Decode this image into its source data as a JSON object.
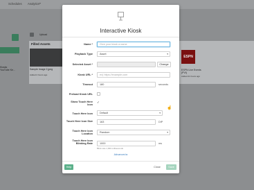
{
  "topbar": {
    "menu1": "Schedules",
    "menu2": "Analytics",
    "menu2_arrow": "▾"
  },
  "background": {
    "left_text": "Kiosks\nYouTube Ke...",
    "upload_label": "Upload",
    "panel_title": "Filled Assets",
    "thumb_title": "Sample Image 2.jpeg",
    "thumb_sub": "Added 2 hours ago",
    "espn": "ESPN",
    "right_text1": "ESPN Live Events",
    "right_text2": "(PVI)",
    "right_text3": "Added 21 hours ago"
  },
  "modal": {
    "title": "Interactive Kiosk",
    "fields": {
      "name": {
        "label": "Name *",
        "placeholder": "Give your kiosk a name"
      },
      "playback_type": {
        "label": "Playback Type",
        "value": "Asset"
      },
      "selected_asset": {
        "label": "Selected Asset *",
        "value": "",
        "change": "Change"
      },
      "kiosk_url": {
        "label": "Kiosk URL *",
        "placeholder": "ex) https://example.com"
      },
      "timeout": {
        "label": "Timeout",
        "value": "180",
        "unit": "seconds"
      },
      "preload": {
        "label": "Preload Kiosk URL"
      },
      "show_touch_icon": {
        "label": "Show Touch Here Icon",
        "checked": "✓"
      },
      "touch_icon": {
        "label": "Touch Here Icon",
        "value": "Default"
      },
      "touch_icon_size": {
        "label": "Touch Here Icon Size",
        "value": "163",
        "unit": "DIP"
      },
      "touch_icon_location": {
        "label": "Touch Here Icon Location",
        "value": "Random"
      },
      "blink_rate": {
        "label": "Touch Here Icon Blinking Rate",
        "value": "1000",
        "unit": "ms",
        "hint": "Blink rate 1,000 milliseconds"
      }
    },
    "advanced": "Advanced ▸",
    "buttons": {
      "help": "Help",
      "close": "Close",
      "save": "Save"
    }
  }
}
